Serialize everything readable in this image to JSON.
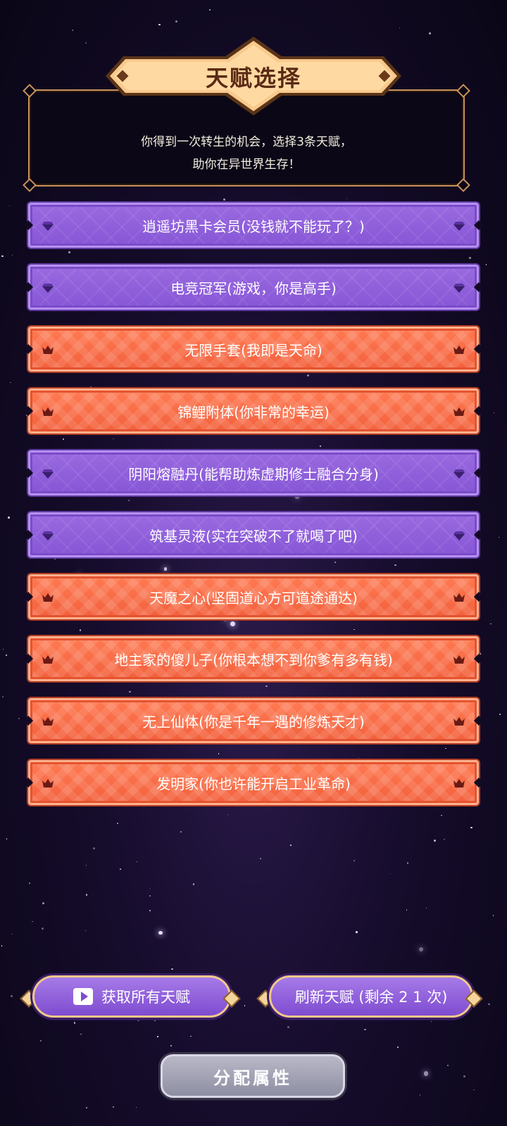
{
  "header": {
    "title": "天赋选择",
    "intro_line1": "你得到一次转生的机会，选择3条天赋，",
    "intro_line2": "助你在异世界生存！"
  },
  "talents": [
    {
      "label": "逍遥坊黑卡会员(没钱就不能玩了？)",
      "rarity": "purple",
      "icon": "gem-icon"
    },
    {
      "label": "电竞冠军(游戏，你是高手)",
      "rarity": "purple",
      "icon": "gem-icon"
    },
    {
      "label": "无限手套(我即是天命)",
      "rarity": "orange",
      "icon": "crown-icon"
    },
    {
      "label": "锦鲤附体(你非常的幸运)",
      "rarity": "orange",
      "icon": "crown-icon"
    },
    {
      "label": "阴阳熔融丹(能帮助炼虚期修士融合分身)",
      "rarity": "purple",
      "icon": "gem-icon"
    },
    {
      "label": "筑基灵液(实在突破不了就喝了吧)",
      "rarity": "purple",
      "icon": "gem-icon"
    },
    {
      "label": "天魔之心(坚固道心方可道途通达)",
      "rarity": "orange",
      "icon": "crown-icon"
    },
    {
      "label": "地主家的傻儿子(你根本想不到你爹有多有钱)",
      "rarity": "orange",
      "icon": "crown-icon"
    },
    {
      "label": "无上仙体(你是千年一遇的修炼天才)",
      "rarity": "orange",
      "icon": "crown-icon"
    },
    {
      "label": "发明家(你也许能开启工业革命)",
      "rarity": "orange",
      "icon": "crown-icon"
    }
  ],
  "buttons": {
    "get_all": "获取所有天赋",
    "refresh": "刷新天赋 (剩余 2 1 次)",
    "allocate": "分配属性"
  },
  "colors": {
    "purple_card": "#8e5ed8",
    "orange_card": "#f56840",
    "gold_border": "#c9925a"
  }
}
